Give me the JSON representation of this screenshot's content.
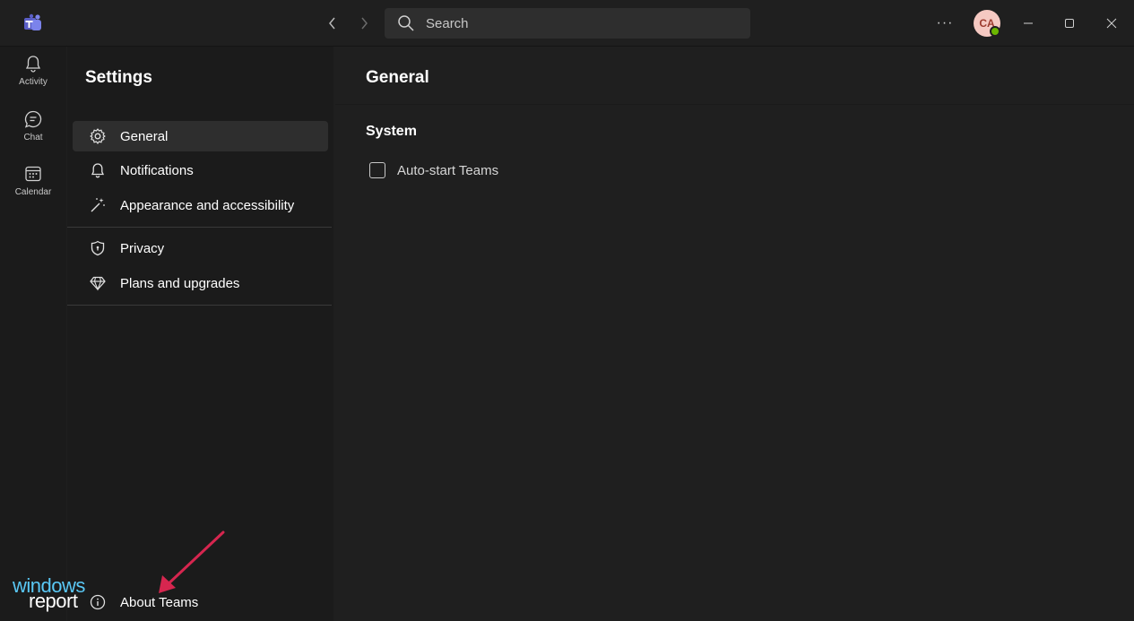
{
  "titlebar": {
    "search_placeholder": "Search",
    "more_label": "···",
    "avatar_initials": "CA"
  },
  "rail": {
    "items": [
      {
        "label": "Activity",
        "icon": "bell-icon"
      },
      {
        "label": "Chat",
        "icon": "chat-icon"
      },
      {
        "label": "Calendar",
        "icon": "calendar-icon"
      }
    ]
  },
  "settings": {
    "title": "Settings",
    "items": [
      {
        "label": "General",
        "icon": "gear-icon",
        "active": true
      },
      {
        "label": "Notifications",
        "icon": "bell-icon"
      },
      {
        "label": "Appearance and accessibility",
        "icon": "magic-wand-icon"
      },
      {
        "label": "Privacy",
        "icon": "shield-icon"
      },
      {
        "label": "Plans and upgrades",
        "icon": "diamond-icon"
      }
    ],
    "about": {
      "label": "About Teams",
      "icon": "info-icon"
    }
  },
  "main": {
    "title": "General",
    "section": "System",
    "auto_start": {
      "label": "Auto-start Teams",
      "checked": false
    }
  },
  "watermark": {
    "line1": "windows",
    "line2": "report"
  },
  "colors": {
    "background": "#1f1f1f",
    "panel": "#1b1b1b",
    "active_item": "#2e2e2e",
    "accent": "#7b83eb",
    "presence": "#6bb700",
    "annotation_arrow": "#d6264f",
    "watermark_blue": "#5ac8f5"
  }
}
